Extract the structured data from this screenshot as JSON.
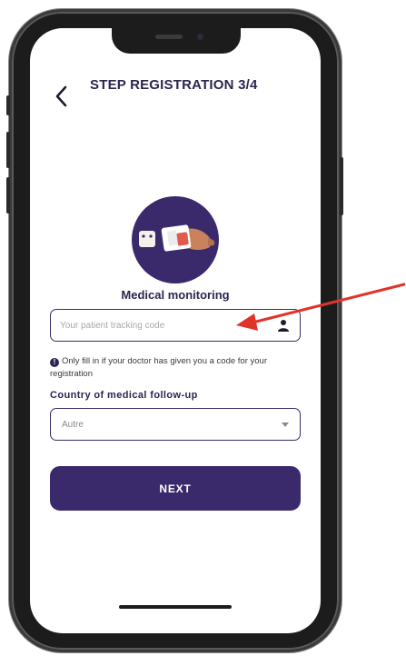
{
  "header": {
    "title": "STEP REGISTRATION 3/4",
    "back_icon": "chevron-left-icon"
  },
  "illustration": {
    "icon": "blood-pressure-cuff-icon",
    "circle_color": "#3b2a6b"
  },
  "section": {
    "title": "Medical monitoring"
  },
  "tracking_code": {
    "placeholder": "Your patient tracking code",
    "value": "",
    "icon": "person-icon"
  },
  "info": {
    "icon": "info-icon",
    "text": "Only fill in if your doctor has given you a code for your registration"
  },
  "country": {
    "label": "Country of medical follow-up",
    "selected": "Autre",
    "icon": "chevron-down-icon"
  },
  "next_button": {
    "label": "NEXT"
  },
  "colors": {
    "primary": "#3b2a6b",
    "text_dark": "#2d2450",
    "annotation_arrow": "#e0342b"
  }
}
